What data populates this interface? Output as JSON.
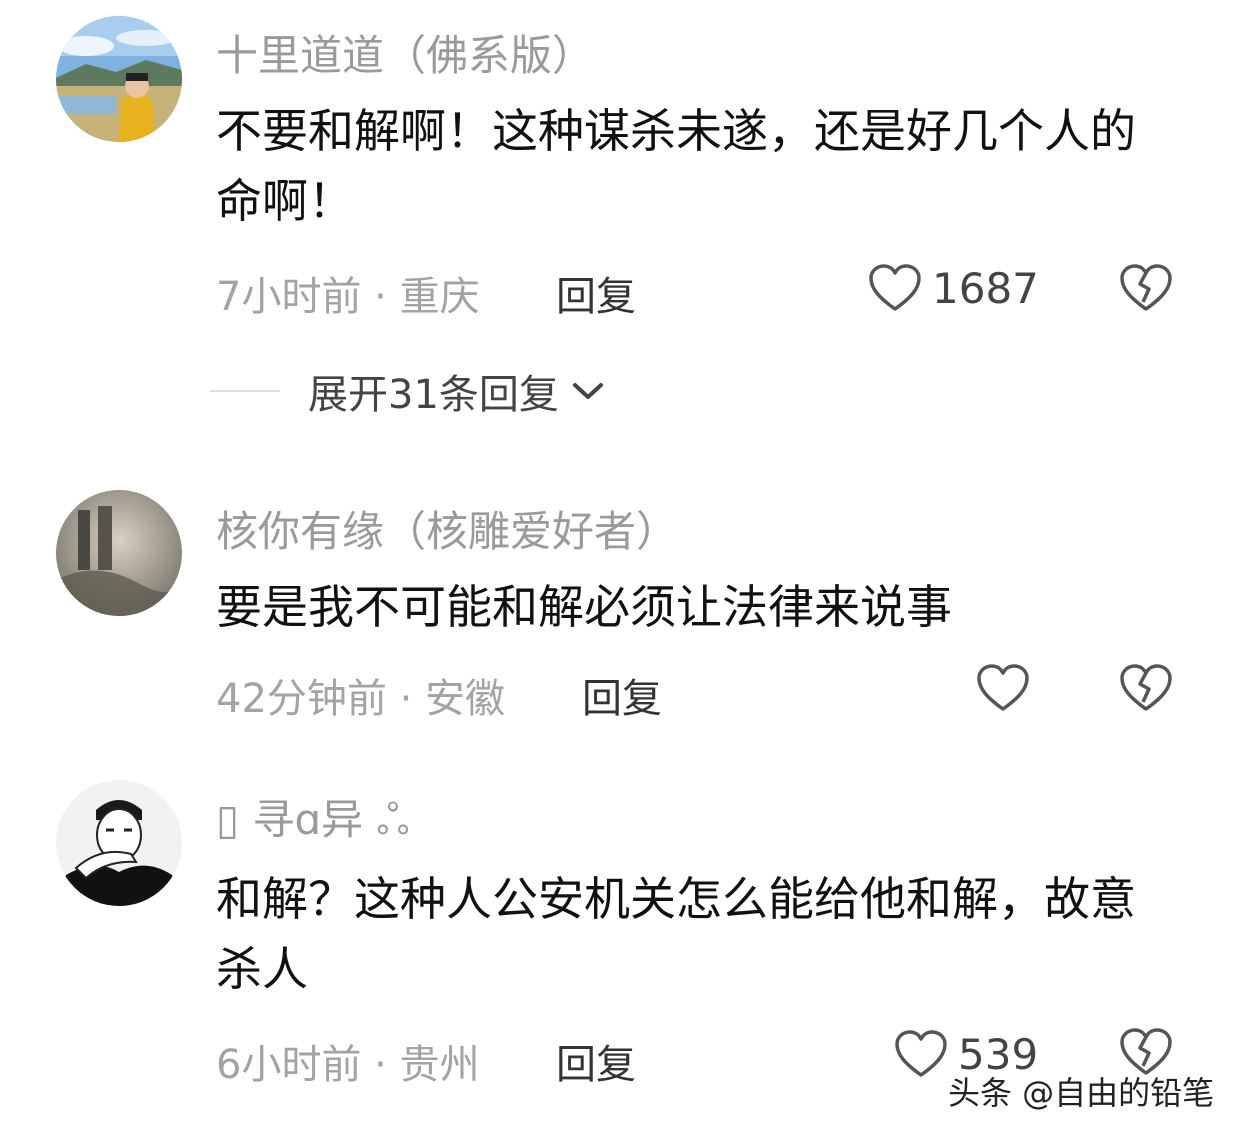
{
  "comments": [
    {
      "username": "十里道道（佛系版）",
      "text": "不要和解啊！这种谋杀未遂，还是好几个人的命啊！",
      "meta": "7小时前 · 重庆",
      "reply_label": "回复",
      "like_count": "1687"
    },
    {
      "username": "核你有缘（核雕爱好者）",
      "text": "要是我不可能和解必须让法律来说事",
      "meta": "42分钟前 · 安徽",
      "reply_label": "回复",
      "like_count": ""
    },
    {
      "username": "▯ 寻ɑ异 ஃ",
      "text": "和解？这种人公安机关怎么能给他和解，故意杀人",
      "meta": "6小时前 · 贵州",
      "reply_label": "回复",
      "like_count": "539"
    }
  ],
  "expand_replies": "展开31条回复",
  "watermark": "头条 @自由的铅笔",
  "icons": {
    "like": "heart-outline-icon",
    "dislike": "broken-heart-icon",
    "expand": "chevron-down-icon"
  },
  "colors": {
    "username": "#9a9a9a",
    "meta": "#a3a3a3",
    "text": "#111111",
    "icon": "#555555"
  }
}
